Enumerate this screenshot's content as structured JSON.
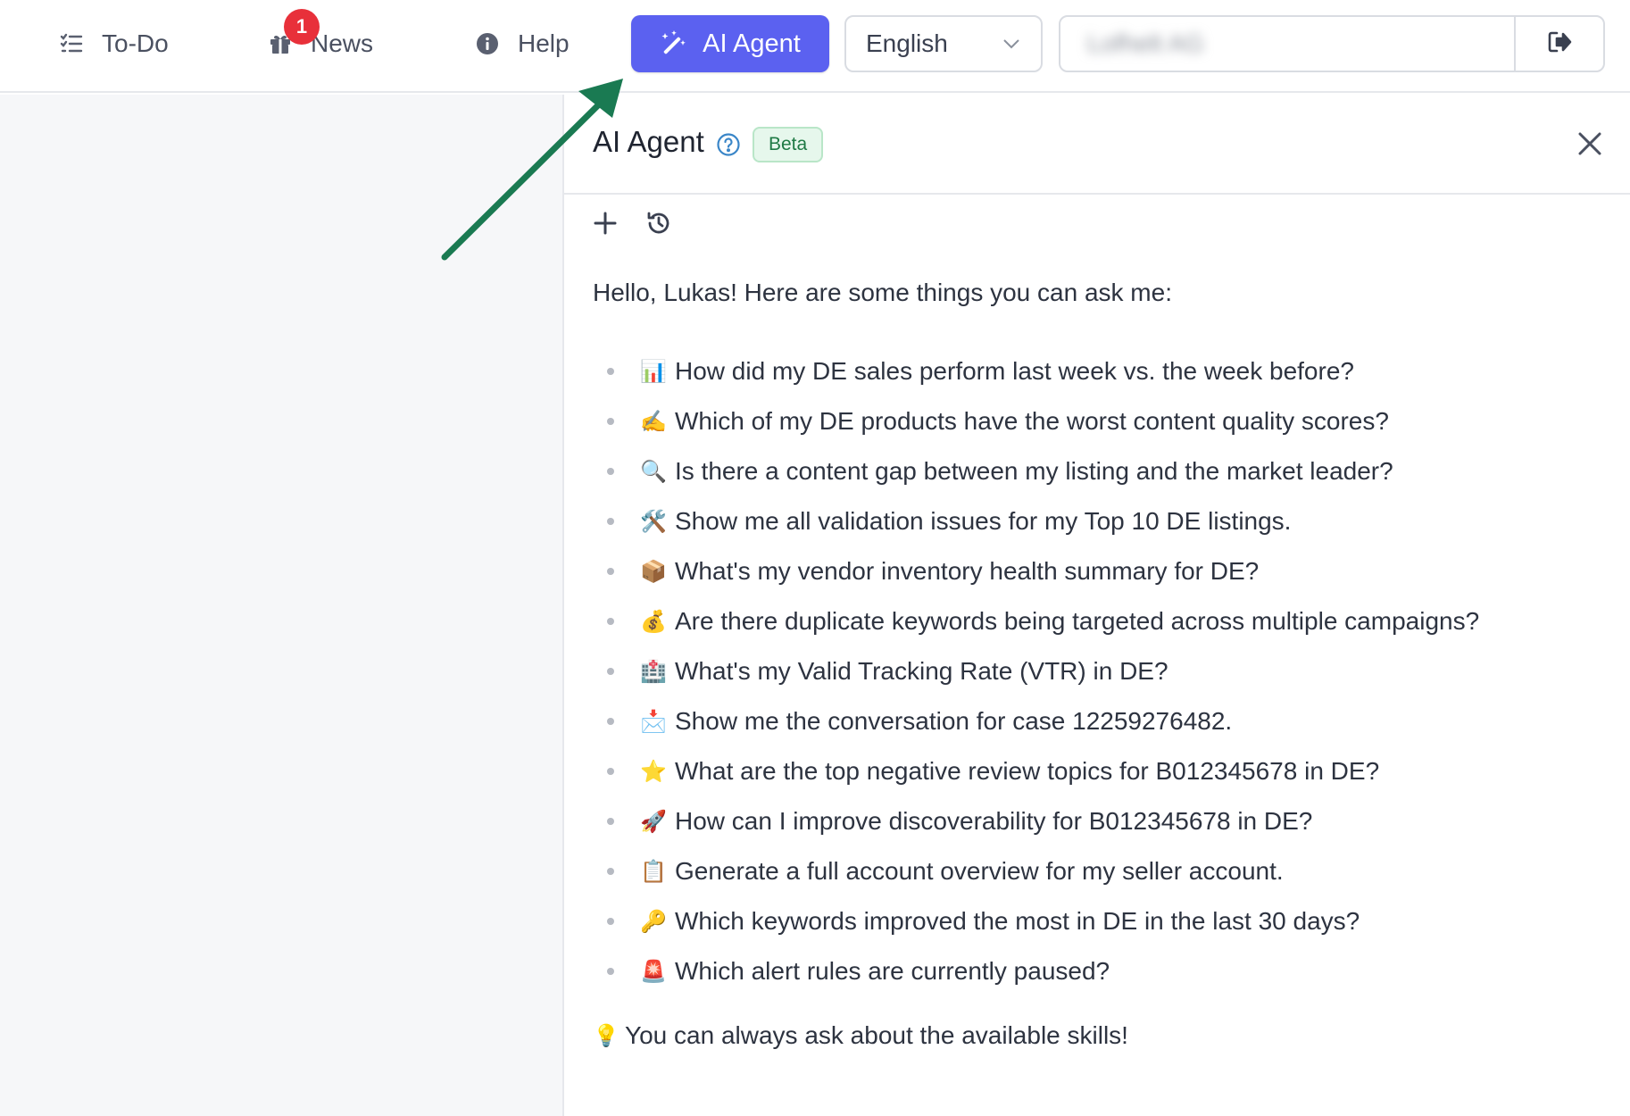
{
  "nav": {
    "todo_label": "To-Do",
    "news_label": "News",
    "news_badge": "1",
    "help_label": "Help",
    "ai_agent_label": "AI Agent"
  },
  "language": {
    "selected": "English"
  },
  "account": {
    "name": "Lofhelt AG"
  },
  "panel": {
    "title": "AI Agent",
    "beta_label": "Beta",
    "greeting": "Hello, Lukas! Here are some things you can ask me:",
    "suggestions": [
      {
        "emoji": "📊",
        "text": "How did my DE sales perform last week vs. the week before?"
      },
      {
        "emoji": "✍️",
        "text": "Which of my DE products have the worst content quality scores?"
      },
      {
        "emoji": "🔍",
        "text": "Is there a content gap between my listing and the market leader?"
      },
      {
        "emoji": "🛠️",
        "text": "Show me all validation issues for my Top 10 DE listings."
      },
      {
        "emoji": "📦",
        "text": "What's my vendor inventory health summary for DE?"
      },
      {
        "emoji": "💰",
        "text": "Are there duplicate keywords being targeted across multiple campaigns?"
      },
      {
        "emoji": "🏥",
        "text": "What's my Valid Tracking Rate (VTR) in DE?"
      },
      {
        "emoji": "📩",
        "text": "Show me the conversation for case 12259276482."
      },
      {
        "emoji": "⭐",
        "text": "What are the top negative review topics for B012345678 in DE?"
      },
      {
        "emoji": "🚀",
        "text": "How can I improve discoverability for B012345678 in DE?"
      },
      {
        "emoji": "📋",
        "text": "Generate a full account overview for my seller account."
      },
      {
        "emoji": "🔑",
        "text": "Which keywords improved the most in DE in the last 30 days?"
      },
      {
        "emoji": "🚨",
        "text": "Which alert rules are currently paused?"
      }
    ],
    "tip_emoji": "💡",
    "tip": "You can always ask about the available skills!"
  },
  "colors": {
    "accent": "#5b61f0",
    "badge": "#e8303a",
    "arrow": "#1a7a52",
    "beta_bg": "#e6f7ec",
    "beta_text": "#1f7a45"
  }
}
